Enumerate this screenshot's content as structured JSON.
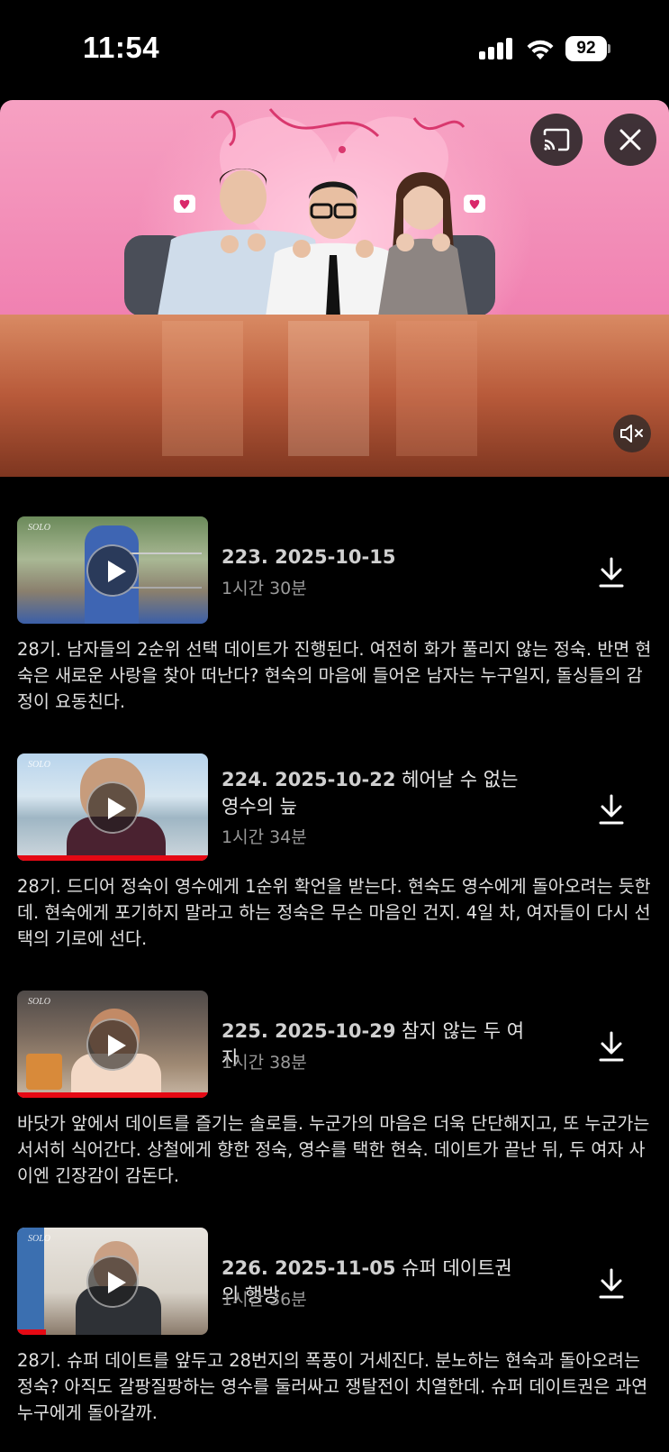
{
  "status_bar": {
    "time": "11:54",
    "battery": "92"
  },
  "hero": {
    "cast_icon": "cast-icon",
    "close_icon": "close-icon",
    "mute_icon": "muted-speaker-icon"
  },
  "episodes": [
    {
      "number_date": "223. 2025-10-15",
      "subtitle": "",
      "duration": "1시간 30분",
      "description": "28기. 남자들의 2순위 선택 데이트가 진행된다. 여전히 화가 풀리지 않는 정숙. 반면 현숙은 새로운 사랑을 찾아 떠난다? 현숙의 마음에 들어온 남자는 누구일지, 돌싱들의 감정이 요동친다.",
      "watched_fraction": 0
    },
    {
      "number_date": "224. 2025-10-22",
      "subtitle": "헤어날 수 없는 영수의 늪",
      "duration": "1시간 34분",
      "description": "28기. 드디어 정숙이 영수에게 1순위 확언을 받는다. 현숙도 영수에게 돌아오려는 듯한데. 현숙에게 포기하지 말라고 하는 정숙은 무슨 마음인 건지. 4일 차, 여자들이 다시 선택의 기로에 선다.",
      "watched_fraction": 1
    },
    {
      "number_date": "225. 2025-10-29",
      "subtitle": "참지 않는 두 여자",
      "duration": "1시간 38분",
      "description": "바닷가 앞에서 데이트를 즐기는 솔로들. 누군가의 마음은 더욱 단단해지고, 또 누군가는 서서히 식어간다. 상철에게 향한 정숙, 영수를 택한 현숙. 데이트가 끝난 뒤, 두 여자 사이엔 긴장감이 감돈다.",
      "watched_fraction": 1
    },
    {
      "number_date": "226. 2025-11-05",
      "subtitle": "슈퍼 데이트권의 행방",
      "duration": "1시간 36분",
      "description": "28기. 슈퍼 데이트를 앞두고 28번지의 폭풍이 거세진다. 분노하는 현숙과 돌아오려는 정숙? 아직도 갈팡질팡하는 영수를 둘러싸고 쟁탈전이 치열한데. 슈퍼 데이트권은 과연 누구에게 돌아갈까.",
      "watched_fraction": 0.15
    }
  ],
  "accent_color": "#e50914"
}
